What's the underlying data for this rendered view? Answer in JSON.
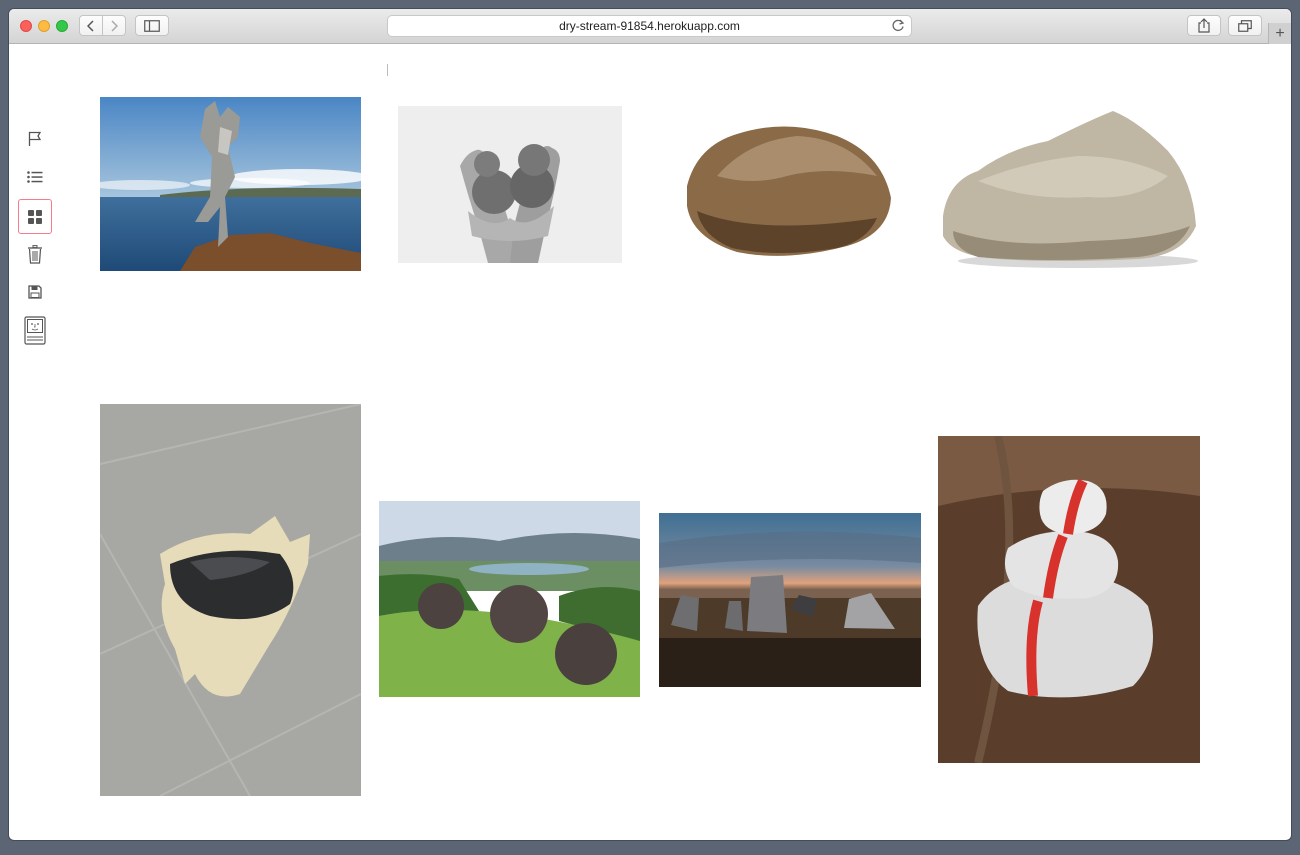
{
  "browser": {
    "url": "dry-stream-91854.herokuapp.com",
    "new_tab_label": "+"
  },
  "sidebar": {
    "items": [
      {
        "icon": "flag-icon",
        "active": false
      },
      {
        "icon": "list-icon",
        "active": false
      },
      {
        "icon": "grid-icon",
        "active": true
      },
      {
        "icon": "trash-icon",
        "active": false
      },
      {
        "icon": "save-icon",
        "active": false
      },
      {
        "icon": "computer-face-icon",
        "active": false
      }
    ]
  },
  "colors": {
    "active_border": "#f47c8b",
    "window_bg": "#ffffff",
    "desktop_bg": "#5c6574"
  },
  "gallery": {
    "images": [
      {
        "subject": "stacked stone sculpture by the sea"
      },
      {
        "subject": "hands holding stones, black and white"
      },
      {
        "subject": "smooth brown boulder"
      },
      {
        "subject": "rough beige rock"
      },
      {
        "subject": "dark stone on cloth on tiled floor"
      },
      {
        "subject": "stone spheres on grass hillside"
      },
      {
        "subject": "standing stones at dusk"
      },
      {
        "subject": "stacked white stones with red stripe"
      }
    ]
  }
}
